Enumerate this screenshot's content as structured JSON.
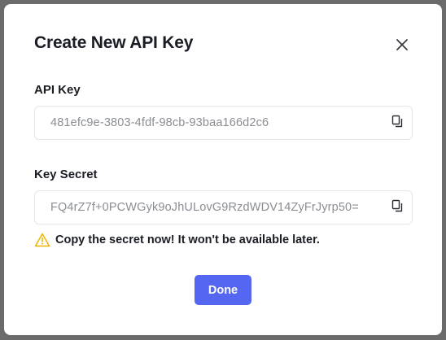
{
  "dialog": {
    "title": "Create New API Key"
  },
  "api_key": {
    "label": "API Key",
    "value": "481efc9e-3803-4fdf-98cb-93baa166d2c6"
  },
  "key_secret": {
    "label": "Key Secret",
    "value": "FQ4rZ7f+0PCWGyk9oJhULovG9RzdWDV14ZyFrJyrp50="
  },
  "warning": {
    "text": "Copy the secret now! It won't be available later.",
    "icon": "warning-triangle-icon",
    "color": "#f0b400"
  },
  "actions": {
    "done_label": "Done",
    "accent_color": "#5566f0"
  },
  "icons": {
    "close": "close-icon",
    "copy": "copy-icon"
  }
}
